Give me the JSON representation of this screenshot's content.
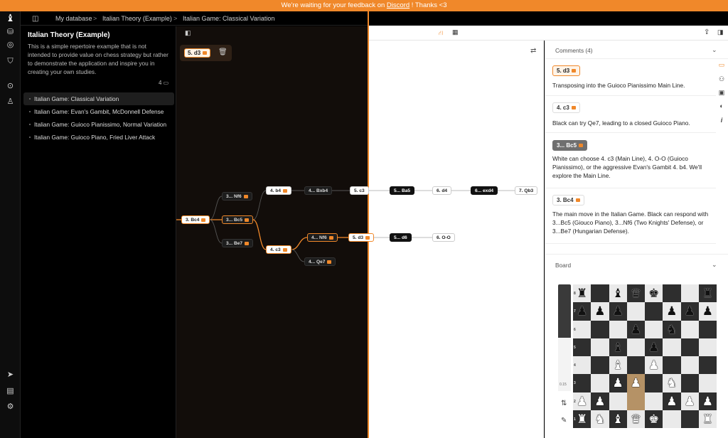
{
  "banner": {
    "prefix": "We're waiting for your feedback on ",
    "link": "Discord",
    "suffix": " ! Thanks <3"
  },
  "rail": {
    "icons": [
      "bishop-logo-icon",
      "database-icon",
      "compass-icon",
      "shield-icon",
      "gamepad-icon",
      "user-icon",
      "send-icon",
      "book-icon",
      "gear-icon"
    ]
  },
  "breadcrumb": {
    "items": [
      "My database",
      "Italian Theory (Example)",
      "Italian Game: Classical Variation"
    ],
    "sep": ">"
  },
  "sidebar": {
    "title": "Italian Theory (Example)",
    "description": "This is a simple repertoire example that is not intended to provide value on chess strategy but rather to demonstrate the application and inspire you in creating your own studies.",
    "count": "4",
    "chapters": [
      {
        "label": "Italian Game: Classical Variation",
        "selected": true
      },
      {
        "label": "Italian Game: Evan's Gambit, McDonnell Defense",
        "selected": false
      },
      {
        "label": "Italian Game: Guioco Pianissimo, Normal Variation",
        "selected": false
      },
      {
        "label": "Italian Game: Guioco Piano, Fried Liver Attack",
        "selected": false
      }
    ]
  },
  "current_move": {
    "label": "5. d3"
  },
  "tree": {
    "nodes": [
      {
        "id": "n1",
        "label": "3. Bc4",
        "style": "w",
        "flag": true,
        "sel": true
      },
      {
        "id": "n2",
        "label": "3... Nf6",
        "style": "d",
        "flag": true
      },
      {
        "id": "n3",
        "label": "3... Bc5",
        "style": "d",
        "flag": true,
        "sel": true
      },
      {
        "id": "n4",
        "label": "3... Be7",
        "style": "d",
        "flag": true
      },
      {
        "id": "n5",
        "label": "4. b4",
        "style": "w",
        "flag": true
      },
      {
        "id": "n6",
        "label": "4... Bxb4",
        "style": "d",
        "flag": false
      },
      {
        "id": "n7",
        "label": "5. c3",
        "style": "w",
        "flag": false
      },
      {
        "id": "n8",
        "label": "5... Ba5",
        "style": "b",
        "flag": false
      },
      {
        "id": "n9",
        "label": "6. d4",
        "style": "w",
        "flag": false
      },
      {
        "id": "n10",
        "label": "6... exd4",
        "style": "b",
        "flag": false
      },
      {
        "id": "n11",
        "label": "7. Qb3",
        "style": "w",
        "flag": false
      },
      {
        "id": "n12",
        "label": "4. c3",
        "style": "w",
        "flag": true,
        "sel": true
      },
      {
        "id": "n13",
        "label": "4... Nf6",
        "style": "d",
        "flag": true,
        "sel": true
      },
      {
        "id": "n14",
        "label": "5. d3",
        "style": "w",
        "flag": true,
        "sel": true
      },
      {
        "id": "n15",
        "label": "5... d6",
        "style": "b",
        "flag": false
      },
      {
        "id": "n16",
        "label": "6. O-O",
        "style": "w",
        "flag": false
      },
      {
        "id": "n17",
        "label": "4... Qe7",
        "style": "d",
        "flag": true
      }
    ]
  },
  "comments": {
    "header": "Comments (4)",
    "items": [
      {
        "move": "5. d3",
        "style": "ot",
        "text": "Transposing into the Guioco Pianissimo Main Line."
      },
      {
        "move": "4. c3",
        "style": "wt",
        "text": "Black can try Qe7, leading to a closed Guioco Piano."
      },
      {
        "move": "3... Bc5",
        "style": "gt",
        "text": "White can choose 4. c3 (Main Line), 4. O-O (Guioco Pianissimo), or the aggressive Evan's Gambit 4. b4. We'll explore the Main Line."
      },
      {
        "move": "3. Bc4",
        "style": "wt",
        "text": "The main move in the Italian Game. Black can respond with 3...Bc5 (Giouco Piano), 3...Nf6 (Two Knights' Defense), or 3...Be7 (Hungarian Defense)."
      }
    ]
  },
  "board": {
    "header": "Board",
    "eval": "0.15",
    "fen_rows": [
      "r.bqk..r",
      "ppp..ppp",
      "...p.n..",
      "..b.p...",
      "..B.P...",
      "..PP.N..",
      "PP...PPP",
      "RNBQK..R"
    ],
    "ranks": [
      "8",
      "7",
      "6",
      "5",
      "4",
      "3",
      "2",
      "1"
    ]
  }
}
